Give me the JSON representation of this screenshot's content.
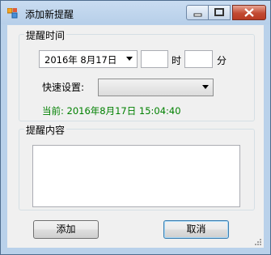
{
  "window": {
    "title": "添加新提醒",
    "icon": "app-window-icon"
  },
  "reminder_time": {
    "legend": "提醒时间",
    "date_value": "2016年  8月17日",
    "hour_value": "",
    "hour_label": "时",
    "minute_value": "",
    "minute_label": "分",
    "quick_setting_label": "快速设置:",
    "quick_setting_value": "",
    "current_text": "当前: 2016年8月17日  15:04:40"
  },
  "reminder_content": {
    "legend": "提醒内容",
    "text": ""
  },
  "buttons": {
    "add": "添加",
    "cancel": "取消"
  },
  "colors": {
    "current_text": "#008000",
    "close_button": "#c24b33"
  }
}
